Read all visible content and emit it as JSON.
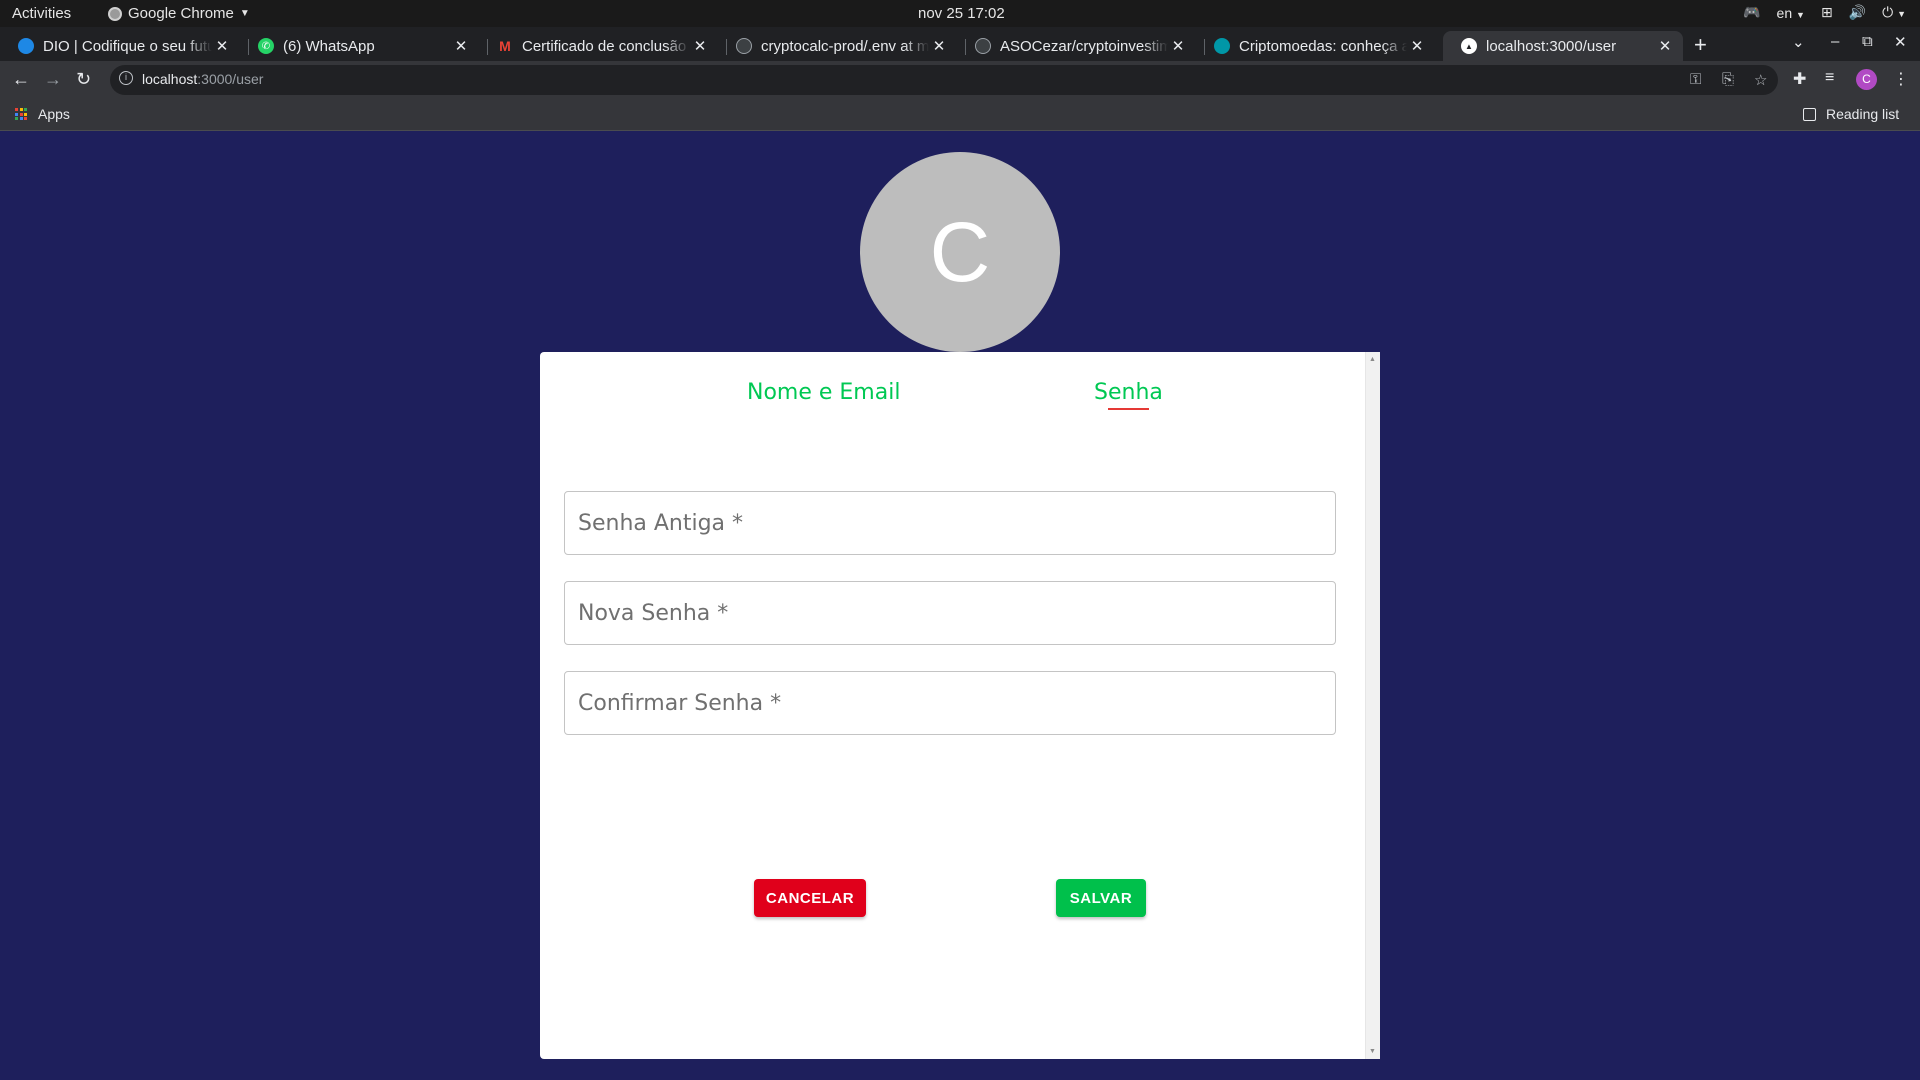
{
  "system_bar": {
    "activities": "Activities",
    "app_name": "Google Chrome",
    "clock": "nov 25  17:02",
    "language": "en"
  },
  "browser": {
    "tabs": [
      {
        "title": "DIO | Codifique o seu futuro",
        "favicon_color": "#1e88e5"
      },
      {
        "title": "(6) WhatsApp",
        "favicon_color": "#25d366"
      },
      {
        "title": "Certificado de conclusão",
        "favicon_color": "#ea4335"
      },
      {
        "title": "cryptocalc-prod/.env at main",
        "favicon_color": "#3c4043"
      },
      {
        "title": "ASOCezar/cryptoinvestimentos",
        "favicon_color": "#3c4043"
      },
      {
        "title": "Criptomoedas: conheça as",
        "favicon_color": "#0097a7"
      },
      {
        "title": "localhost:3000/user",
        "favicon_color": "#202124"
      }
    ],
    "url_host": "localhost",
    "url_path": ":3000/user",
    "bookmarks_apps": "Apps",
    "reading_list": "Reading list",
    "profile_initial": "C"
  },
  "page": {
    "avatar_initial": "C",
    "tabs": [
      "Nome e Email",
      "Senha"
    ],
    "active_tab": "Senha",
    "fields": {
      "old_password": "Senha Antiga *",
      "new_password": "Nova Senha *",
      "confirm_password": "Confirmar Senha *"
    },
    "buttons": {
      "cancel": "CANCELAR",
      "save": "SALVAR"
    },
    "colors": {
      "background": "#1e1f5c",
      "accent_green": "#00c853",
      "cancel_red": "#e0001b",
      "tab_indicator": "#e53935"
    }
  }
}
